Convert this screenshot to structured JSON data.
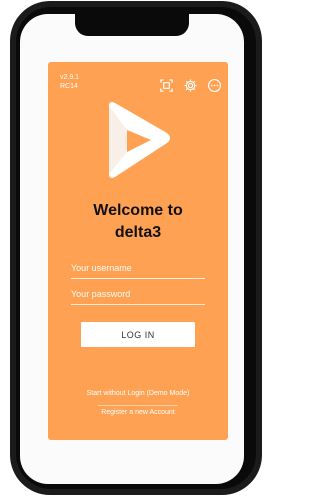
{
  "app": {
    "version": "v2.9.1",
    "build": "RC14",
    "welcome_line1": "Welcome to",
    "welcome_line2": "delta3"
  },
  "form": {
    "username_placeholder": "Your username",
    "password_placeholder": "Your password",
    "login_label": "LOG IN"
  },
  "links": {
    "demo_mode": "Start without Login (Demo Mode)",
    "register": "Register a new Account"
  },
  "icons": [
    "qr-scan-icon",
    "gear-icon",
    "more-icon"
  ],
  "colors": {
    "card": "#ffa152",
    "screen": "#fbfbfb",
    "logo": "#ffffff"
  }
}
